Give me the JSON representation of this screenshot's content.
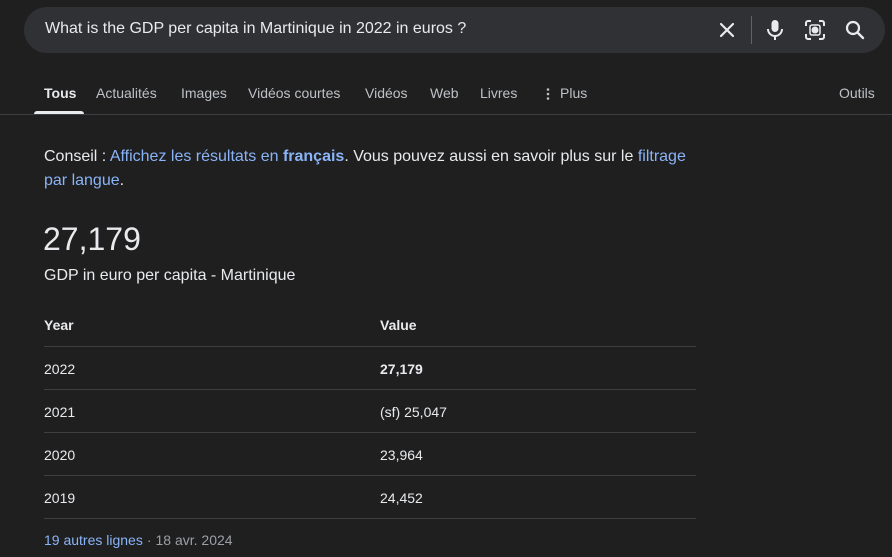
{
  "search": {
    "query": "What is the GDP per capita in Martinique in 2022 in euros ?",
    "icons": [
      "close-icon",
      "microphone-icon",
      "lens-icon",
      "search-icon"
    ]
  },
  "tabs": [
    {
      "label": "Tous",
      "active": true
    },
    {
      "label": "Actualités"
    },
    {
      "label": "Images"
    },
    {
      "label": "Vidéos courtes"
    },
    {
      "label": "Vidéos"
    },
    {
      "label": "Web"
    },
    {
      "label": "Livres"
    },
    {
      "label": "Plus"
    },
    {
      "label": "Outils"
    }
  ],
  "tip": {
    "prefix": "Conseil : ",
    "link1_text": "Affichez les résultats en ",
    "link1_bold": "français",
    "middle": ". Vous pouvez aussi en savoir plus sur le ",
    "link2": "filtrage par langue",
    "suffix": "."
  },
  "answer": {
    "value": "27,179",
    "subtitle": "GDP in euro per capita - Martinique"
  },
  "table": {
    "headers": [
      "Year",
      "Value"
    ],
    "rows": [
      {
        "year": "2022",
        "value": "27,179"
      },
      {
        "year": "2021",
        "value": "(sf) 25,047"
      },
      {
        "year": "2020",
        "value": "23,964"
      },
      {
        "year": "2019",
        "value": "24,452"
      }
    ]
  },
  "footer": {
    "more_link": "19 autres lignes",
    "separator": "·",
    "date": "18 avr. 2024"
  },
  "colors": {
    "background": "#1f1f1f",
    "search_bg": "#303134",
    "link": "#8ab4f8",
    "text": "#e8eaed",
    "muted": "#9aa0a6"
  }
}
